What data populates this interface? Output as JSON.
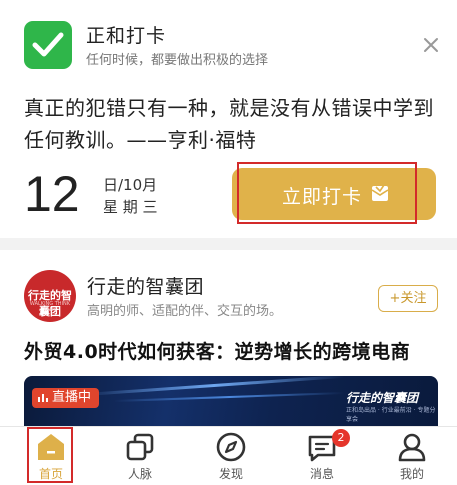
{
  "checkin_card": {
    "app_name": "正和打卡",
    "app_subtitle": "任何时候，都要做出积极的选择",
    "quote": "真正的犯错只有一种，就是没有从错误中学到任何教训。——亨利·福特",
    "day": "12",
    "date_line": "日/10月",
    "weekday": "星 期 三",
    "checkin_label": "立即打卡",
    "accent_color": "#e0b24a",
    "icon_color": "#2fb64a",
    "icons": {
      "app": "checkmark-icon",
      "close": "close-icon",
      "checkin": "envelope-check-icon"
    }
  },
  "feed": {
    "account_name": "行走的智囊团",
    "account_desc": "高明的师、适配的伴、交互的场。",
    "avatar_text": "行走的智囊团",
    "avatar_subtext": "WALKING THINK TANK",
    "follow_label": "+关注",
    "headline": "外贸4.0时代如何获客：逆势增长的跨境电商",
    "live_label": "直播中",
    "banner_brand": "行走的智囊团",
    "banner_subtext": "正和岛出品 · 行业最前沿 · 专题分享会"
  },
  "tabbar": {
    "tabs": [
      {
        "label": "首页",
        "icon": "home-icon",
        "active": true
      },
      {
        "label": "人脉",
        "icon": "contacts-icon",
        "active": false
      },
      {
        "label": "发现",
        "icon": "compass-icon",
        "active": false
      },
      {
        "label": "消息",
        "icon": "message-icon",
        "active": false,
        "badge": "2"
      },
      {
        "label": "我的",
        "icon": "profile-icon",
        "active": false
      }
    ],
    "active_color": "#d8a53c"
  }
}
